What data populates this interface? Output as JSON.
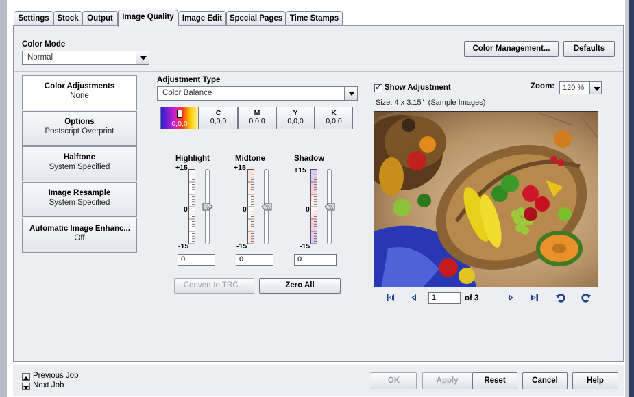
{
  "tabs": [
    {
      "label": "Settings"
    },
    {
      "label": "Stock"
    },
    {
      "label": "Output"
    },
    {
      "label": "Image Quality"
    },
    {
      "label": "Image Edit"
    },
    {
      "label": "Special Pages"
    },
    {
      "label": "Time Stamps"
    }
  ],
  "active_tab": "Image Quality",
  "color_mode": {
    "label": "Color Mode",
    "value": "Normal"
  },
  "top_buttons": {
    "color_management": "Color Management...",
    "defaults": "Defaults"
  },
  "categories": [
    {
      "title": "Color Adjustments",
      "sub": "None",
      "selected": true
    },
    {
      "title": "Options",
      "sub": "Postscript Overprint",
      "selected": false
    },
    {
      "title": "Halftone",
      "sub": "System Specified",
      "selected": false
    },
    {
      "title": "Image Resample",
      "sub": "System Specified",
      "selected": false
    },
    {
      "title": "Automatic Image Enhanc...",
      "sub": "Off",
      "selected": false
    }
  ],
  "adjustment": {
    "label": "Adjustment Type",
    "value": "Color Balance",
    "channels": [
      {
        "name": "",
        "value": "0,0,0",
        "selected": true
      },
      {
        "name": "C",
        "value": "0,0,0"
      },
      {
        "name": "M",
        "value": "0,0,0"
      },
      {
        "name": "Y",
        "value": "0,0,0"
      },
      {
        "name": "K",
        "value": "0,0,0"
      }
    ],
    "sliders": [
      {
        "title": "Highlight",
        "max": "+15",
        "mid": "0",
        "min": "-15",
        "value": "0",
        "level": 0
      },
      {
        "title": "Midtone",
        "max": "+15",
        "mid": "0",
        "min": "-15",
        "value": "0",
        "level": 0
      },
      {
        "title": "Shadow",
        "max": "+15",
        "mid": "0",
        "min": "-15",
        "value": "0",
        "level": 0
      }
    ],
    "convert_label": "Convert to TRC...",
    "zero_all_label": "Zero All"
  },
  "preview": {
    "show_adjustment": "Show Adjustment",
    "show_checked": true,
    "zoom_label": "Zoom:",
    "zoom_value": "120 %",
    "size_text": "Size: 4 x 3.15\"  (Sample Images)",
    "page_value": "1",
    "page_of": "of 3",
    "nav_icons": [
      "first-page-icon",
      "prev-page-icon",
      "next-page-icon",
      "last-page-icon",
      "rotate-left-icon",
      "rotate-right-icon"
    ]
  },
  "job_nav": {
    "previous": "Previous Job",
    "next": "Next Job"
  },
  "footer_buttons": {
    "ok": "OK",
    "apply": "Apply",
    "reset": "Reset",
    "cancel": "Cancel",
    "help": "Help"
  },
  "colors": {
    "panel": "#eceef2",
    "tab_border": "#7f8696",
    "nav_icon": "#1c3f8a"
  }
}
